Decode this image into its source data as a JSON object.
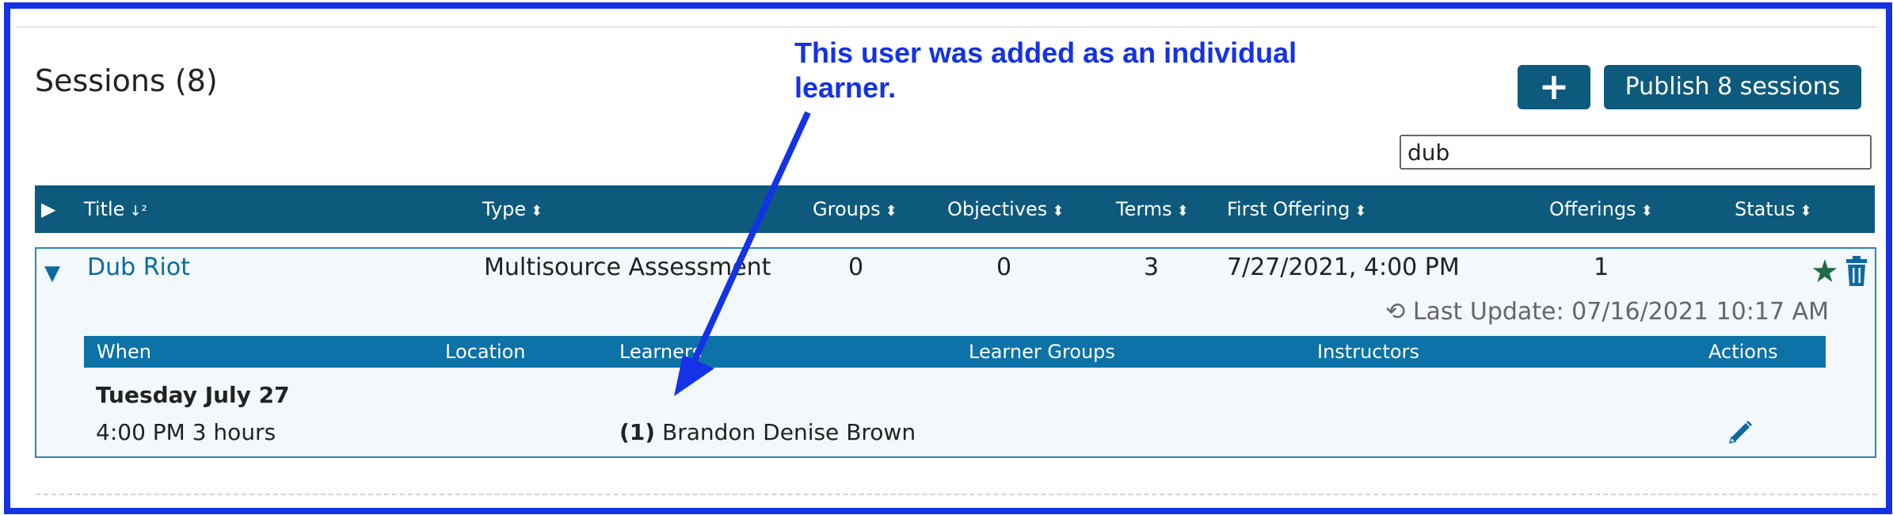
{
  "page": {
    "title": "Sessions (8)"
  },
  "toolbar": {
    "add_label": "+",
    "publish_label": "Publish 8 sessions"
  },
  "search": {
    "value": "dub"
  },
  "table": {
    "columns": [
      "Title",
      "Type",
      "Groups",
      "Objectives",
      "Terms",
      "First Offering",
      "Offerings",
      "Status"
    ],
    "rows": [
      {
        "title": "Dub Riot",
        "type": "Multisource Assessment",
        "groups": "0",
        "objectives": "0",
        "terms": "3",
        "first_offering": "7/27/2021, 4:00 PM",
        "offerings": "1",
        "last_update": "Last Update: 07/16/2021 10:17 AM",
        "offering_table": {
          "columns": [
            "When",
            "Location",
            "Learners",
            "Learner Groups",
            "Instructors",
            "Actions"
          ],
          "date_heading": "Tuesday July 27",
          "rows": [
            {
              "when": "4:00 PM 3 hours",
              "learner_count": "(1)",
              "learner_name": "Brandon Denise Brown"
            }
          ]
        }
      }
    ]
  },
  "annotation": {
    "text": "This user was added as an individual learner."
  },
  "colors": {
    "header": "#0d5a7c",
    "sub_header": "#0d72a8",
    "link": "#0d6aa0",
    "annotation": "#1432e6",
    "star": "#1e6c46"
  },
  "icons": [
    "sort-icon",
    "expand-all-icon",
    "collapse-icon",
    "star-icon",
    "trash-icon",
    "history-icon",
    "edit-icon"
  ]
}
